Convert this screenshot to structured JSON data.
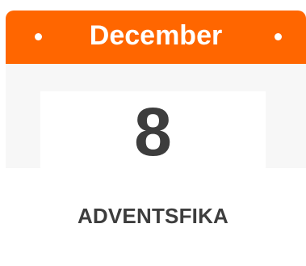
{
  "calendar": {
    "month": "December",
    "day": "8",
    "header_color": "#ff6600",
    "text_color": "#3d3d3d"
  },
  "event": {
    "title": "ADVENTSFIKA"
  }
}
